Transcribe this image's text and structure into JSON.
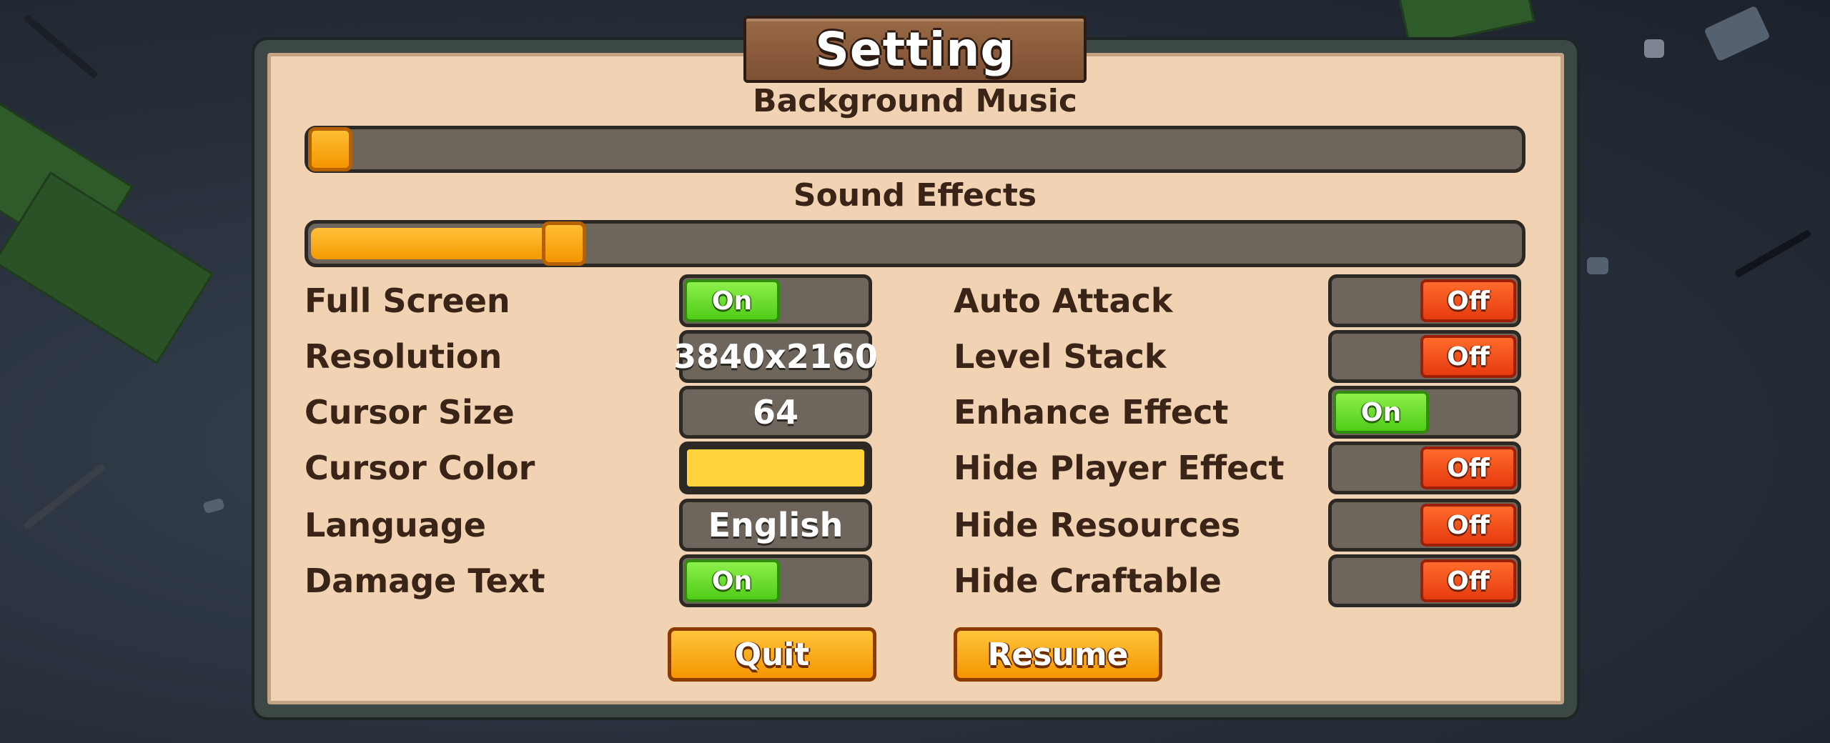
{
  "title": "Setting",
  "audio": {
    "background_music_label": "Background Music",
    "background_music_level": 0.0,
    "sound_effects_label": "Sound Effects",
    "sound_effects_level": 0.2
  },
  "left_settings": {
    "full_screen": {
      "label": "Full Screen",
      "state": "On"
    },
    "resolution": {
      "label": "Resolution",
      "value": "3840x2160"
    },
    "cursor_size": {
      "label": "Cursor Size",
      "value": "64"
    },
    "cursor_color": {
      "label": "Cursor Color",
      "color": "#ffd43b"
    },
    "language": {
      "label": "Language",
      "value": "English"
    },
    "damage_text": {
      "label": "Damage Text",
      "state": "On"
    }
  },
  "right_settings": {
    "auto_attack": {
      "label": "Auto Attack",
      "state": "Off"
    },
    "level_stack": {
      "label": "Level Stack",
      "state": "Off"
    },
    "enhance_effect": {
      "label": "Enhance Effect",
      "state": "On"
    },
    "hide_player_effect": {
      "label": "Hide Player Effect",
      "state": "Off"
    },
    "hide_resources": {
      "label": "Hide Resources",
      "state": "Off"
    },
    "hide_craftable": {
      "label": "Hide Craftable",
      "state": "Off"
    }
  },
  "buttons": {
    "quit": "Quit",
    "resume": "Resume"
  },
  "colors": {
    "on": "#5ad21e",
    "off": "#f0481a",
    "accent_orange": "#f59a00",
    "panel_bg": "#f1d2b3"
  }
}
